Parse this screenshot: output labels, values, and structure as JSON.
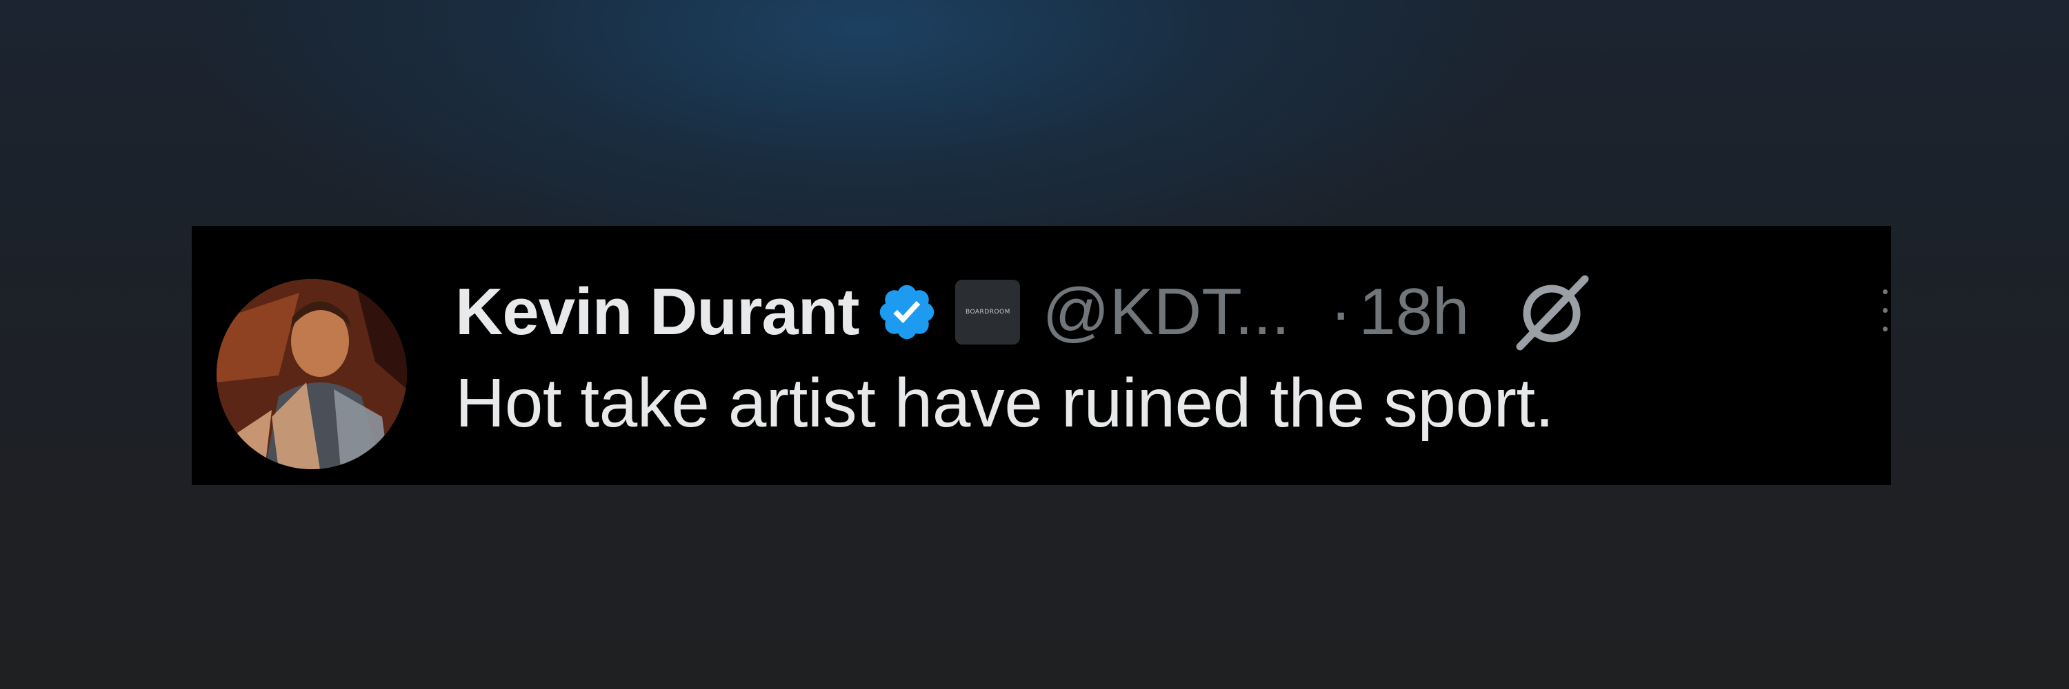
{
  "tweet": {
    "display_name": "Kevin Durant",
    "handle": "@KDT...",
    "separator": "·",
    "timestamp": "18h",
    "text": "Hot take artist have ruined the sport.",
    "verified_icon": "verified-badge-icon",
    "affiliate_badge_text": "BOARDROOM",
    "grok_icon": "grok-icon",
    "more_icon": "more-options-icon",
    "avatar": "profile-avatar"
  },
  "colors": {
    "background": "#1e1f21",
    "card": "#000000",
    "name": "#e7e9ea",
    "secondary": "#71767b",
    "verified": "#1d9bf0"
  }
}
